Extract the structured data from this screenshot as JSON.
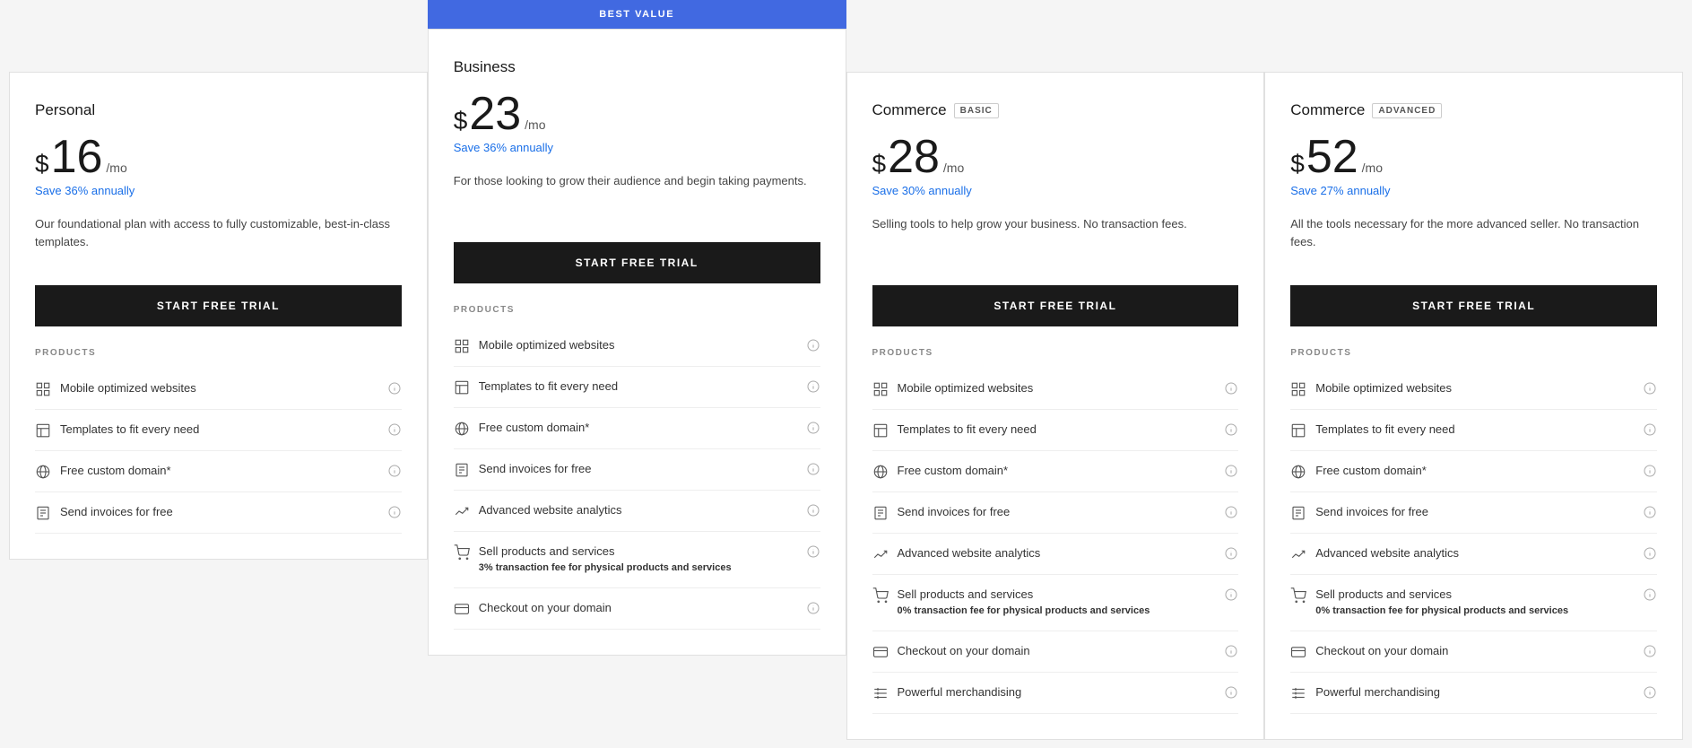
{
  "plans": [
    {
      "id": "personal",
      "name": "Personal",
      "badge": null,
      "bestValue": false,
      "price": "16",
      "period": "/mo",
      "saveText": "Save 36% annually",
      "description": "Our foundational plan with access to fully customizable, best-in-class templates.",
      "ctaLabel": "START FREE TRIAL",
      "sectionLabel": "PRODUCTS",
      "features": [
        {
          "icon": "grid-icon",
          "text": "Mobile optimized websites",
          "subtext": null
        },
        {
          "icon": "template-icon",
          "text": "Templates to fit every need",
          "subtext": null
        },
        {
          "icon": "globe-icon",
          "text": "Free custom domain*",
          "subtext": null
        },
        {
          "icon": "invoice-icon",
          "text": "Send invoices for free",
          "subtext": null
        }
      ]
    },
    {
      "id": "business",
      "name": "Business",
      "badge": null,
      "bestValue": true,
      "bestValueLabel": "BEST VALUE",
      "price": "23",
      "period": "/mo",
      "saveText": "Save 36% annually",
      "description": "For those looking to grow their audience and begin taking payments.",
      "ctaLabel": "START FREE TRIAL",
      "sectionLabel": "PRODUCTS",
      "features": [
        {
          "icon": "grid-icon",
          "text": "Mobile optimized websites",
          "subtext": null
        },
        {
          "icon": "template-icon",
          "text": "Templates to fit every need",
          "subtext": null
        },
        {
          "icon": "globe-icon",
          "text": "Free custom domain*",
          "subtext": null
        },
        {
          "icon": "invoice-icon",
          "text": "Send invoices for free",
          "subtext": null
        },
        {
          "icon": "analytics-icon",
          "text": "Advanced website analytics",
          "subtext": null
        },
        {
          "icon": "cart-icon",
          "text": "Sell products and services",
          "subtext": "3% transaction fee for physical products and services"
        },
        {
          "icon": "checkout-icon",
          "text": "Checkout on your domain",
          "subtext": null
        }
      ]
    },
    {
      "id": "commerce-basic",
      "name": "Commerce",
      "badge": "BASIC",
      "bestValue": false,
      "price": "28",
      "period": "/mo",
      "saveText": "Save 30% annually",
      "description": "Selling tools to help grow your business. No transaction fees.",
      "ctaLabel": "START FREE TRIAL",
      "sectionLabel": "PRODUCTS",
      "features": [
        {
          "icon": "grid-icon",
          "text": "Mobile optimized websites",
          "subtext": null
        },
        {
          "icon": "template-icon",
          "text": "Templates to fit every need",
          "subtext": null
        },
        {
          "icon": "globe-icon",
          "text": "Free custom domain*",
          "subtext": null
        },
        {
          "icon": "invoice-icon",
          "text": "Send invoices for free",
          "subtext": null
        },
        {
          "icon": "analytics-icon",
          "text": "Advanced website analytics",
          "subtext": null
        },
        {
          "icon": "cart-icon",
          "text": "Sell products and services",
          "subtext": "0% transaction fee for physical products and services"
        },
        {
          "icon": "checkout-icon",
          "text": "Checkout on your domain",
          "subtext": null
        },
        {
          "icon": "merch-icon",
          "text": "Powerful merchandising",
          "subtext": null
        }
      ]
    },
    {
      "id": "commerce-advanced",
      "name": "Commerce",
      "badge": "ADVANCED",
      "bestValue": false,
      "price": "52",
      "period": "/mo",
      "saveText": "Save 27% annually",
      "description": "All the tools necessary for the more advanced seller. No transaction fees.",
      "ctaLabel": "START FREE TRIAL",
      "sectionLabel": "PRODUCTS",
      "features": [
        {
          "icon": "grid-icon",
          "text": "Mobile optimized websites",
          "subtext": null
        },
        {
          "icon": "template-icon",
          "text": "Templates to fit every need",
          "subtext": null
        },
        {
          "icon": "globe-icon",
          "text": "Free custom domain*",
          "subtext": null
        },
        {
          "icon": "invoice-icon",
          "text": "Send invoices for free",
          "subtext": null
        },
        {
          "icon": "analytics-icon",
          "text": "Advanced website analytics",
          "subtext": null
        },
        {
          "icon": "cart-icon",
          "text": "Sell products and services",
          "subtext": "0% transaction fee for physical products and services"
        },
        {
          "icon": "checkout-icon",
          "text": "Checkout on your domain",
          "subtext": null
        },
        {
          "icon": "merch-icon",
          "text": "Powerful merchandising",
          "subtext": null
        }
      ]
    }
  ]
}
